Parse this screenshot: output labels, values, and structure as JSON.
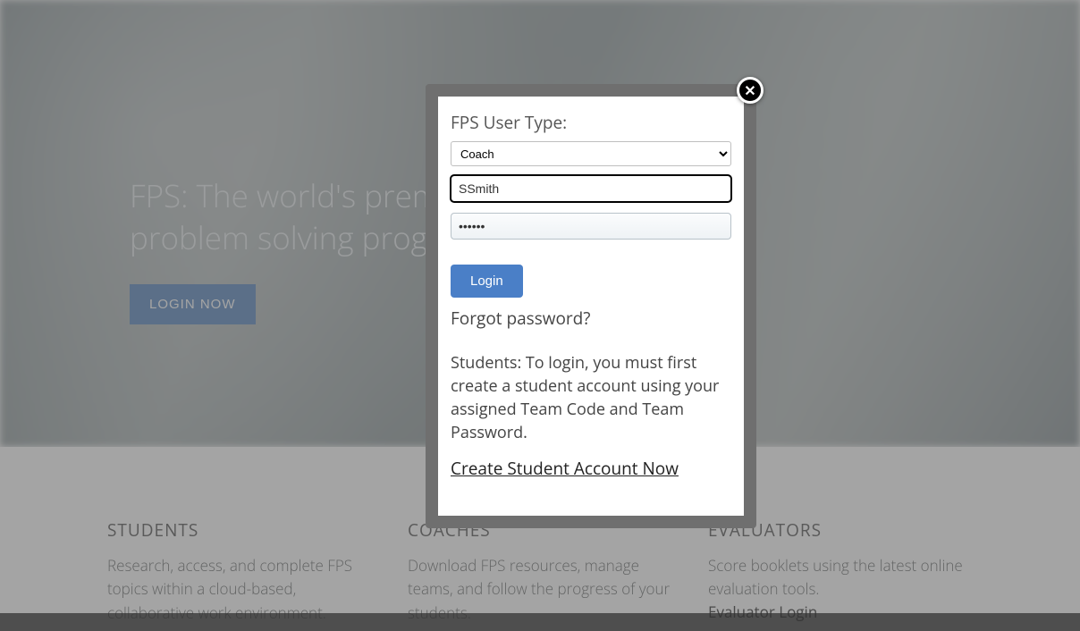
{
  "hero": {
    "line1": "FPS: The world's prem",
    "line2": "problem solving prog",
    "login_now": "LOGIN NOW"
  },
  "columns": {
    "students": {
      "title": "STUDENTS",
      "body": "Research, access, and complete FPS topics within a cloud-based, collaborative work environment."
    },
    "coaches": {
      "title": "COACHES",
      "body": "Download FPS resources, manage teams, and follow the progress of your students."
    },
    "evaluators": {
      "title": "EVALUATORS",
      "body": "Score booklets using the latest online evaluation tools.",
      "link": "Evaluator Login"
    }
  },
  "modal": {
    "user_type_label": "FPS User Type:",
    "user_type_selected": "Coach",
    "username_value": "SSmith",
    "password_value": "••••••",
    "login_button": "Login",
    "forgot": "Forgot password?",
    "student_note": "Students: To login, you must first create a student account using your assigned Team Code and Team Password.",
    "create_link": "Create Student Account Now",
    "close_icon": "✕"
  }
}
